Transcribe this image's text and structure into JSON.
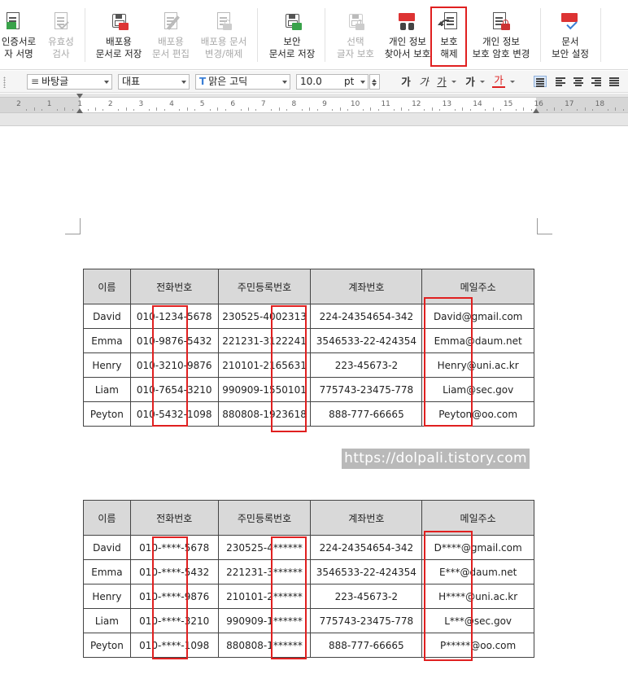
{
  "ribbon": {
    "buttons": [
      {
        "line1": "인증서로",
        "line2": "자 서명",
        "disabled": false
      },
      {
        "line1": "유효성",
        "line2": "검사",
        "disabled": true
      },
      {
        "line1": "배포용",
        "line2": "문서로 저장",
        "disabled": false
      },
      {
        "line1": "배포용",
        "line2": "문서 편집",
        "disabled": true
      },
      {
        "line1": "배포용 문서",
        "line2": "변경/해제",
        "disabled": true
      },
      {
        "line1": "보안",
        "line2": "문서로 저장",
        "disabled": false
      },
      {
        "line1": "선택",
        "line2": "글자 보호",
        "disabled": true
      },
      {
        "line1": "개인 정보",
        "line2": "찾아서 보호",
        "disabled": false
      },
      {
        "line1": "보호",
        "line2": "해제",
        "disabled": false
      },
      {
        "line1": "개인 정보",
        "line2": "보호 암호 변경",
        "disabled": false
      },
      {
        "line1": "문서",
        "line2": "보안 설정",
        "disabled": false
      }
    ]
  },
  "format_bar": {
    "style": "바탕글",
    "language": "대표",
    "font": "맑은 고딕",
    "font_prefix": "T",
    "size": "10.0",
    "size_unit": "pt",
    "bold_label": "가",
    "italic_label": "가",
    "underline_label": "가",
    "strike_label": "가",
    "color_label": "가"
  },
  "ruler": {
    "labels": [
      "2",
      "1",
      "1",
      "2",
      "3",
      "4",
      "5",
      "6",
      "7",
      "8",
      "9",
      "10",
      "11",
      "12",
      "13",
      "14",
      "15",
      "16",
      "17",
      "18"
    ]
  },
  "watermark": "https://dolpali.tistory.com",
  "table_original": {
    "headers": [
      "이름",
      "전화번호",
      "주민등록번호",
      "계좌번호",
      "메일주소"
    ],
    "rows": [
      [
        "David",
        "010-1234-5678",
        "230525-4002313",
        "224-24354654-342",
        "David@gmail.com"
      ],
      [
        "Emma",
        "010-9876-5432",
        "221231-3122241",
        "3546533-22-424354",
        "Emma@daum.net"
      ],
      [
        "Henry",
        "010-3210-9876",
        "210101-2165631",
        "223-45673-2",
        "Henry@uni.ac.kr"
      ],
      [
        "Liam",
        "010-7654-3210",
        "990909-1550101",
        "775743-23475-778",
        "Liam@sec.gov"
      ],
      [
        "Peyton",
        "010-5432-1098",
        "880808-1923618",
        "888-777-66665",
        "Peyton@oo.com"
      ]
    ]
  },
  "table_masked": {
    "headers": [
      "이름",
      "전화번호",
      "주민등록번호",
      "계좌번호",
      "메일주소"
    ],
    "rows": [
      [
        "David",
        "010-****-5678",
        "230525-4******",
        "224-24354654-342",
        "D****@gmail.com"
      ],
      [
        "Emma",
        "010-****-5432",
        "221231-3******",
        "3546533-22-424354",
        "E***@daum.net"
      ],
      [
        "Henry",
        "010-****-9876",
        "210101-2******",
        "223-45673-2",
        "H****@uni.ac.kr"
      ],
      [
        "Liam",
        "010-****-3210",
        "990909-1******",
        "775743-23475-778",
        "L***@sec.gov"
      ],
      [
        "Peyton",
        "010-****-1098",
        "880808-1******",
        "888-777-66665",
        "P*****@oo.com"
      ]
    ]
  }
}
